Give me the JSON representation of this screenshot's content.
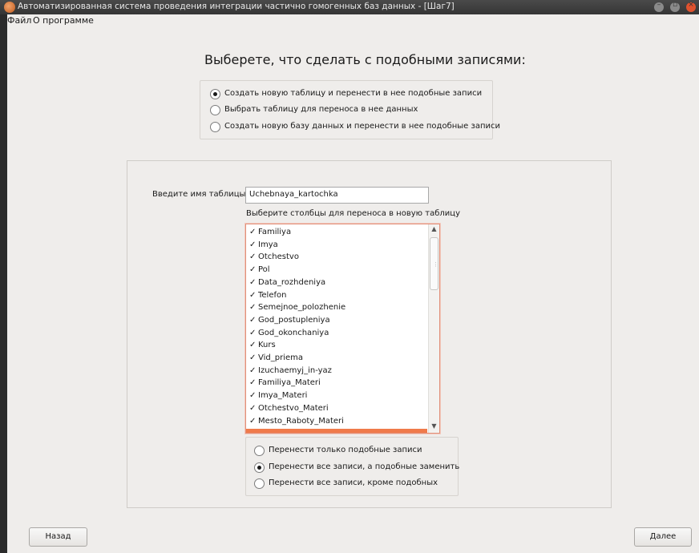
{
  "window": {
    "title": "Автоматизированная система проведения интеграции частично гомогенных баз данных - [Шаг7]"
  },
  "menu": [
    {
      "label": "Файл"
    },
    {
      "label": "О программе"
    }
  ],
  "heading": "Выберете, что сделать с подобными записями:",
  "action_options": [
    {
      "label": "Создать новую таблицу и перенести в нее подобные записи",
      "checked": true
    },
    {
      "label": "Выбрать таблицу для переноса в нее данных",
      "checked": false
    },
    {
      "label": "Создать новую базу данных и перенести в нее подобные записи",
      "checked": false
    }
  ],
  "table_name": {
    "label": "Введите имя таблицы",
    "value": "Uchebnaya_kartochka"
  },
  "columns_label": "Выберите столбцы для переноса в новую таблицу",
  "columns": [
    {
      "name": "Familiya",
      "checked": true
    },
    {
      "name": "Imya",
      "checked": true
    },
    {
      "name": "Otchestvo",
      "checked": true
    },
    {
      "name": "Pol",
      "checked": true
    },
    {
      "name": "Data_rozhdeniya",
      "checked": true
    },
    {
      "name": "Telefon",
      "checked": true
    },
    {
      "name": "Semejnoe_polozhenie",
      "checked": true
    },
    {
      "name": "God_postupleniya",
      "checked": true
    },
    {
      "name": "God_okonchaniya",
      "checked": true
    },
    {
      "name": "Kurs",
      "checked": true
    },
    {
      "name": "Vid_priema",
      "checked": true
    },
    {
      "name": "Izuchaemyj_in-yaz",
      "checked": true
    },
    {
      "name": "Familiya_Materi",
      "checked": true
    },
    {
      "name": "Imya_Materi",
      "checked": true
    },
    {
      "name": "Otchestvo_Materi",
      "checked": true
    },
    {
      "name": "Mesto_Raboty_Materi",
      "checked": true
    }
  ],
  "transfer_options": [
    {
      "label": "Перенести только подобные записи",
      "checked": false
    },
    {
      "label": "Перенести все записи, а подобные заменить",
      "checked": true
    },
    {
      "label": "Перенести все записи, кроме подобных",
      "checked": false
    }
  ],
  "buttons": {
    "back": "Назад",
    "next": "Далее"
  },
  "colors": {
    "accent": "#f07a4a",
    "close_button": "#e0522e"
  },
  "icons": {
    "app": "app-icon",
    "check": "check-icon",
    "scroll_up": "arrow-up-icon",
    "scroll_down": "arrow-down-icon"
  }
}
